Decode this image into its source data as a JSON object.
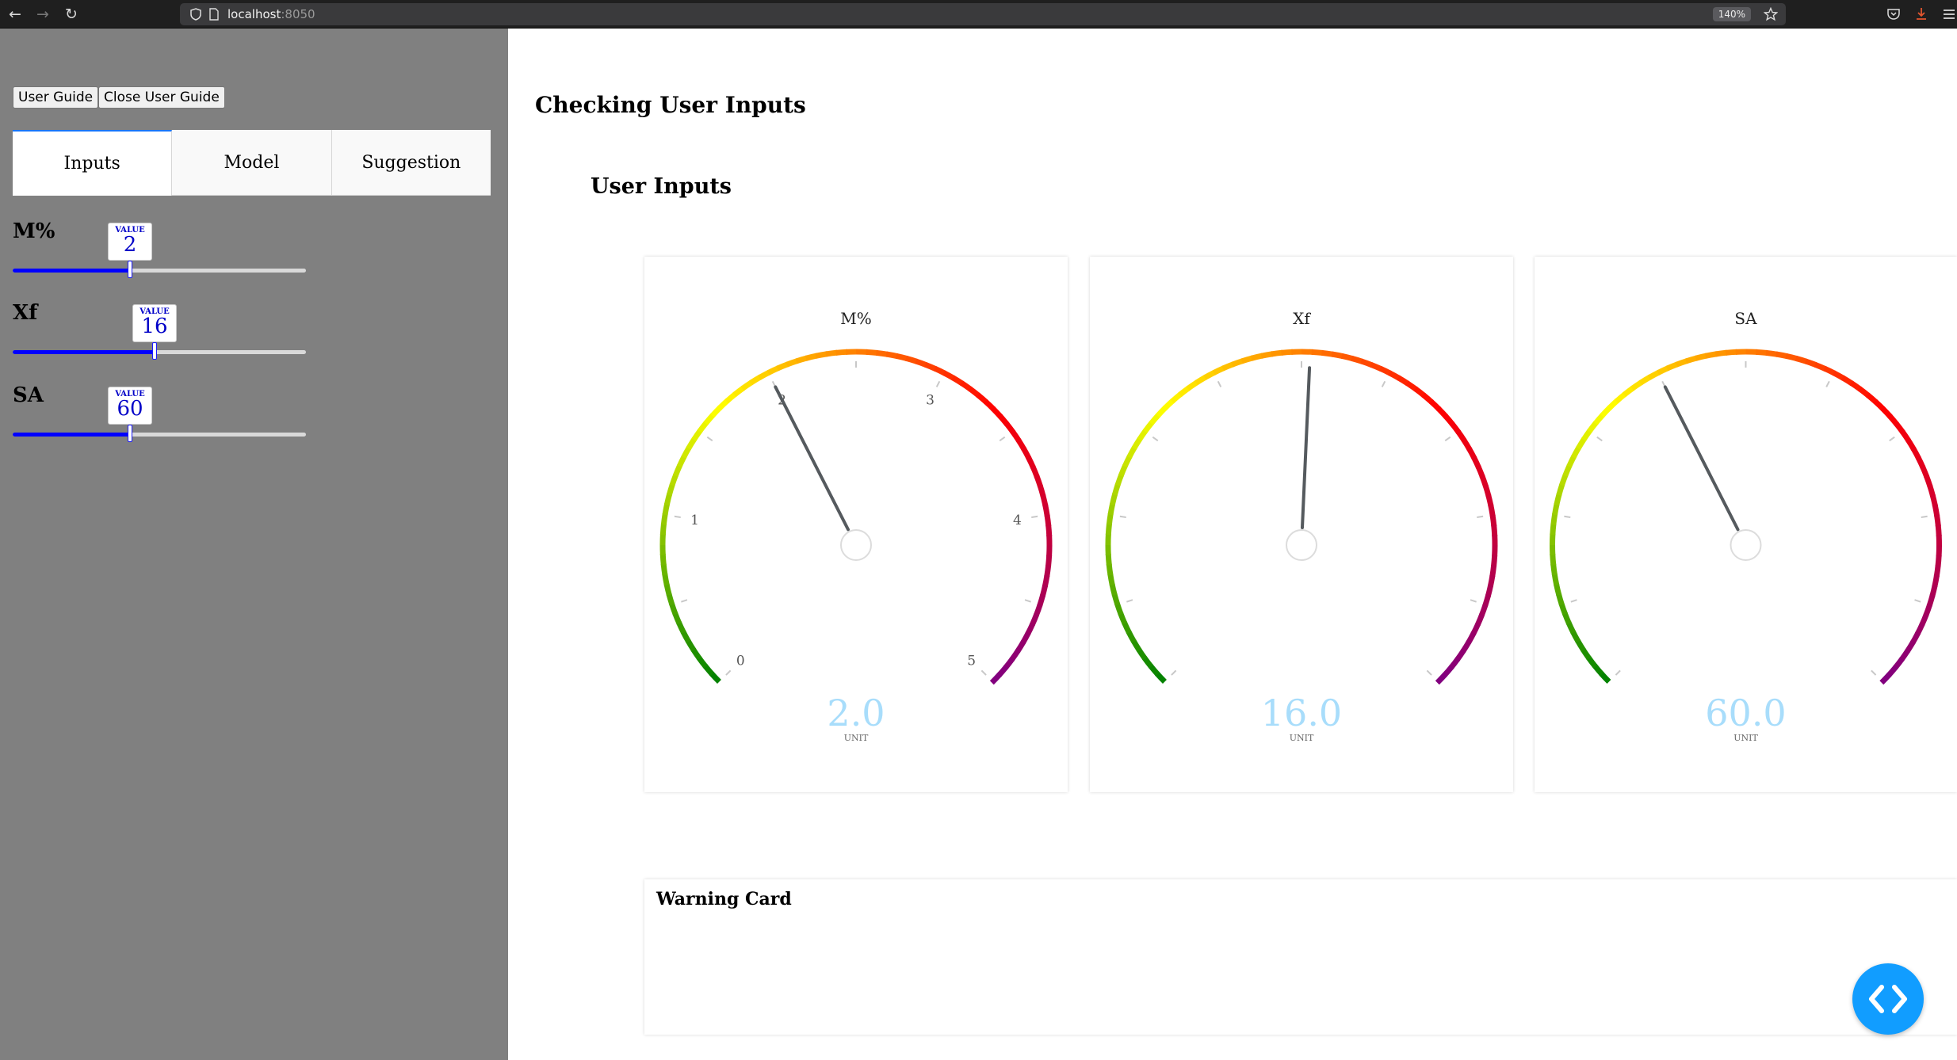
{
  "browser": {
    "url_host": "localhost",
    "url_port": ":8050",
    "zoom": "140%",
    "icons": [
      "back-arrow-icon",
      "forward-arrow-icon",
      "reload-icon",
      "shield-icon",
      "page-icon",
      "star-icon",
      "pocket-icon",
      "download-icon",
      "menu-icon"
    ]
  },
  "sidebar": {
    "user_guide_label": "User Guide",
    "close_guide_label": "Close User Guide",
    "tabs": [
      {
        "label": "Inputs",
        "active": true
      },
      {
        "label": "Model",
        "active": false
      },
      {
        "label": "Suggestion",
        "active": false
      }
    ],
    "sliders": [
      {
        "label": "M%",
        "tooltip_caption": "VALUE",
        "value": "2",
        "fraction": 0.4
      },
      {
        "label": "Xf",
        "tooltip_caption": "VALUE",
        "value": "16",
        "fraction": 0.485
      },
      {
        "label": "SA",
        "tooltip_caption": "VALUE",
        "value": "60",
        "fraction": 0.4
      }
    ],
    "slider_color": "#0000ff"
  },
  "main": {
    "page_title": "Checking User Inputs",
    "section_title": "User Inputs",
    "gauges": [
      {
        "title": "M%",
        "value": 2.0,
        "value_text": "2.0",
        "units": "UNIT",
        "min": 0,
        "max": 5,
        "tick_labels": [
          "0",
          "1",
          "2",
          "3",
          "4",
          "5"
        ]
      },
      {
        "title": "Xf",
        "value": 16.0,
        "value_text": "16.0",
        "units": "UNIT",
        "min": 0,
        "max": 31.4,
        "tick_labels": []
      },
      {
        "title": "SA",
        "value": 60.0,
        "value_text": "60.0",
        "units": "UNIT",
        "min": 0,
        "max": 150,
        "tick_labels": []
      }
    ],
    "gauge_colors": {
      "gradient": [
        "#008000",
        "#ffff00",
        "#ff0000",
        "#800080"
      ],
      "needle": "#555a5e",
      "value": "#a8ddfb"
    },
    "warning_card_title": "Warning Card",
    "fab_icon": "code-icon",
    "fab_color": "#119dff"
  }
}
